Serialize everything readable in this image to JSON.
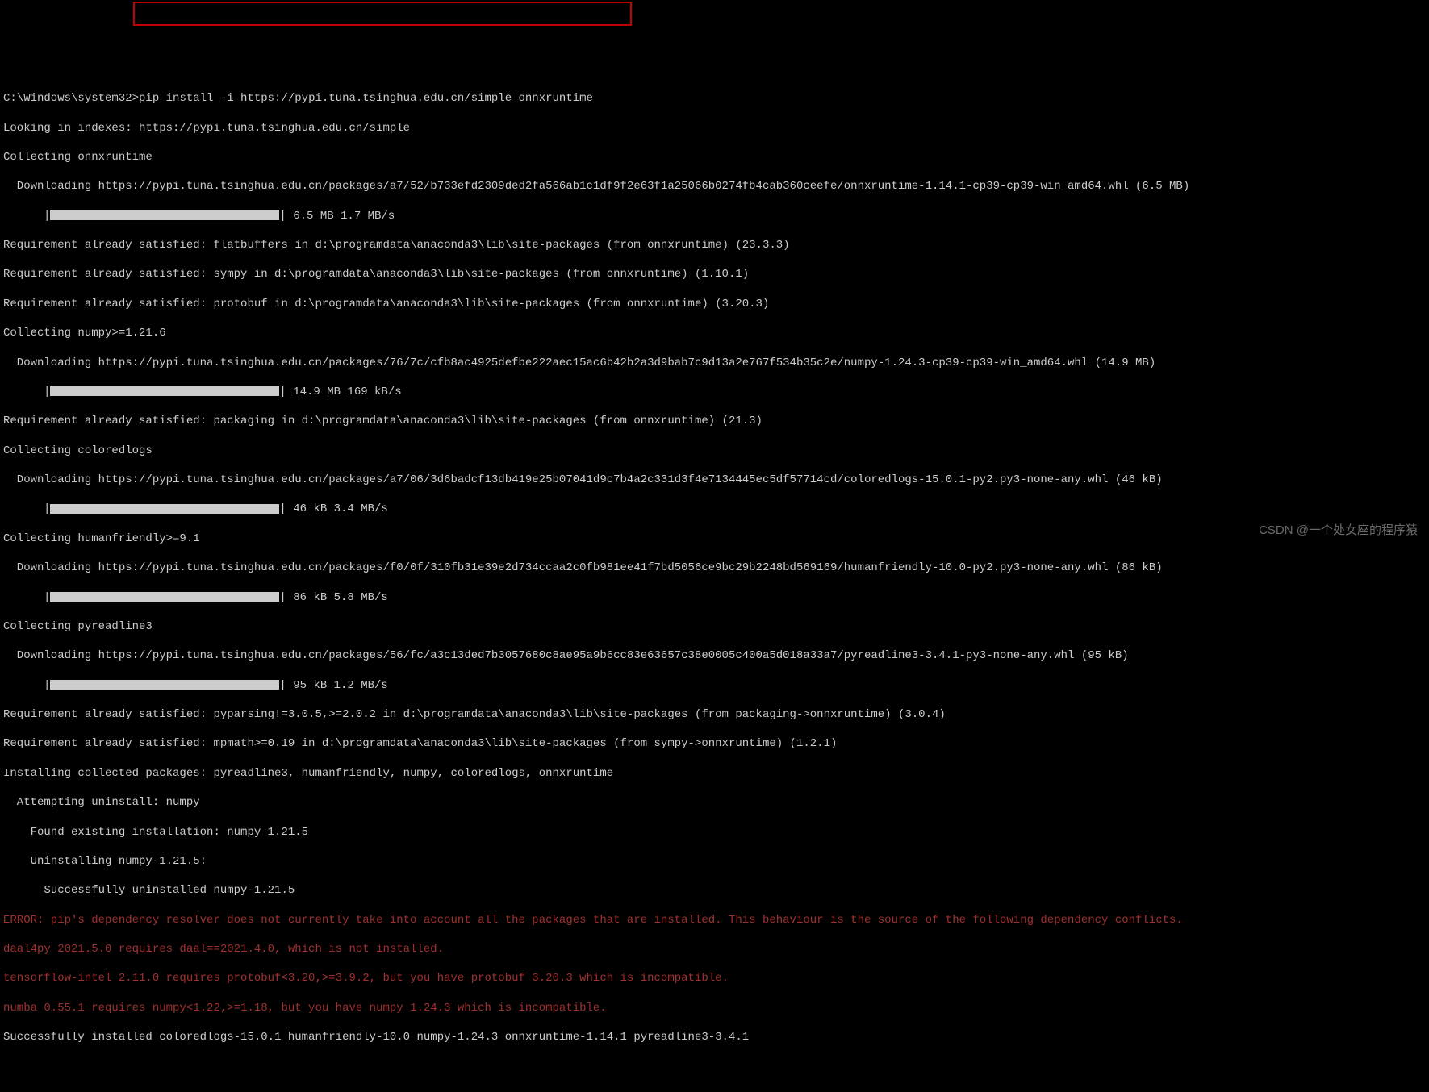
{
  "prompt_prefix": "C:\\Windows\\system32>",
  "command": "pip install -i https://pypi.tuna.tsinghua.edu.cn/simple onnxruntime",
  "lines": {
    "indexes": "Looking in indexes: https://pypi.tuna.tsinghua.edu.cn/simple",
    "collect_onnx": "Collecting onnxruntime",
    "dl_onnx": "  Downloading https://pypi.tuna.tsinghua.edu.cn/packages/a7/52/b733efd2309ded2fa566ab1c1df9f2e63f1a25066b0274fb4cab360ceefe/onnxruntime-1.14.1-cp39-cp39-win_amd64.whl (6.5 MB)",
    "bar_onnx": "| 6.5 MB 1.7 MB/s",
    "req_flat": "Requirement already satisfied: flatbuffers in d:\\programdata\\anaconda3\\lib\\site-packages (from onnxruntime) (23.3.3)",
    "req_sympy": "Requirement already satisfied: sympy in d:\\programdata\\anaconda3\\lib\\site-packages (from onnxruntime) (1.10.1)",
    "req_proto": "Requirement already satisfied: protobuf in d:\\programdata\\anaconda3\\lib\\site-packages (from onnxruntime) (3.20.3)",
    "collect_numpy": "Collecting numpy>=1.21.6",
    "dl_numpy": "  Downloading https://pypi.tuna.tsinghua.edu.cn/packages/76/7c/cfb8ac4925defbe222aec15ac6b42b2a3d9bab7c9d13a2e767f534b35c2e/numpy-1.24.3-cp39-cp39-win_amd64.whl (14.9 MB)",
    "bar_numpy": "| 14.9 MB 169 kB/s",
    "req_pack": "Requirement already satisfied: packaging in d:\\programdata\\anaconda3\\lib\\site-packages (from onnxruntime) (21.3)",
    "collect_colored": "Collecting coloredlogs",
    "dl_colored": "  Downloading https://pypi.tuna.tsinghua.edu.cn/packages/a7/06/3d6badcf13db419e25b07041d9c7b4a2c331d3f4e7134445ec5df57714cd/coloredlogs-15.0.1-py2.py3-none-any.whl (46 kB)",
    "bar_colored": "| 46 kB 3.4 MB/s",
    "collect_human": "Collecting humanfriendly>=9.1",
    "dl_human": "  Downloading https://pypi.tuna.tsinghua.edu.cn/packages/f0/0f/310fb31e39e2d734ccaa2c0fb981ee41f7bd5056ce9bc29b2248bd569169/humanfriendly-10.0-py2.py3-none-any.whl (86 kB)",
    "bar_human": "| 86 kB 5.8 MB/s",
    "collect_pyread": "Collecting pyreadline3",
    "dl_pyread": "  Downloading https://pypi.tuna.tsinghua.edu.cn/packages/56/fc/a3c13ded7b3057680c8ae95a9b6cc83e63657c38e0005c400a5d018a33a7/pyreadline3-3.4.1-py3-none-any.whl (95 kB)",
    "bar_pyread": "| 95 kB 1.2 MB/s",
    "req_pyp": "Requirement already satisfied: pyparsing!=3.0.5,>=2.0.2 in d:\\programdata\\anaconda3\\lib\\site-packages (from packaging->onnxruntime) (3.0.4)",
    "req_mpm": "Requirement already satisfied: mpmath>=0.19 in d:\\programdata\\anaconda3\\lib\\site-packages (from sympy->onnxruntime) (1.2.1)",
    "inst": "Installing collected packages: pyreadline3, humanfriendly, numpy, coloredlogs, onnxruntime",
    "attempt": "  Attempting uninstall: numpy",
    "found": "    Found existing installation: numpy 1.21.5",
    "uninst": "    Uninstalling numpy-1.21.5:",
    "succ_un": "      Successfully uninstalled numpy-1.21.5",
    "err1": "ERROR: pip's dependency resolver does not currently take into account all the packages that are installed. This behaviour is the source of the following dependency conflicts.",
    "err2": "daal4py 2021.5.0 requires daal==2021.4.0, which is not installed.",
    "err3": "tensorflow-intel 2.11.0 requires protobuf<3.20,>=3.9.2, but you have protobuf 3.20.3 which is incompatible.",
    "err4": "numba 0.55.1 requires numpy<1.22,>=1.18, but you have numpy 1.24.3 which is incompatible.",
    "success": "Successfully installed coloredlogs-15.0.1 humanfriendly-10.0 numpy-1.24.3 onnxruntime-1.14.1 pyreadline3-3.4.1"
  },
  "watermark": "CSDN @一个处女座的程序猿"
}
